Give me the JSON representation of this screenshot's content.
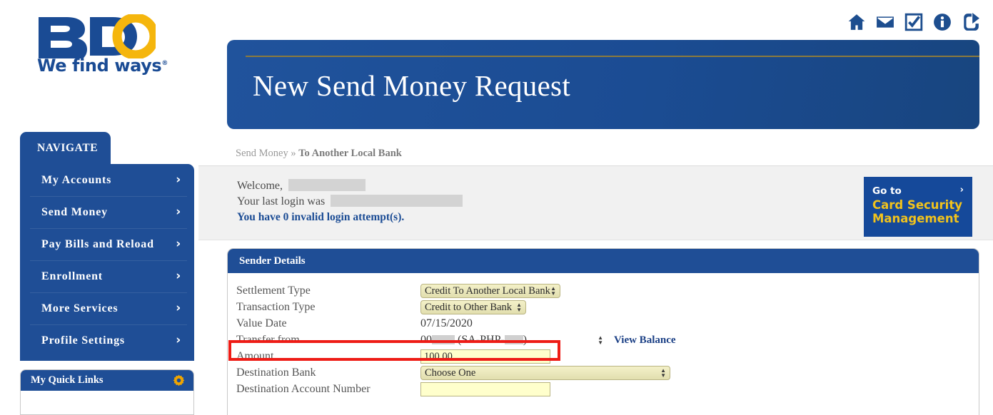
{
  "brand": {
    "name": "BDO",
    "tagline": "We find ways",
    "registered_mark": "®",
    "blue": "#1a4b94",
    "gold": "#f5b60d"
  },
  "topbar": {
    "icons": [
      {
        "name": "home-icon",
        "title": "Home"
      },
      {
        "name": "envelope-icon",
        "title": "Messages"
      },
      {
        "name": "checkbox-checked-icon",
        "title": "Tasks"
      },
      {
        "name": "info-icon",
        "title": "Information"
      },
      {
        "name": "share-icon",
        "title": "Share"
      }
    ]
  },
  "sidebar": {
    "tab_label": "NAVIGATE",
    "chevron": "›",
    "items": [
      {
        "label": "My Accounts"
      },
      {
        "label": "Send Money"
      },
      {
        "label": "Pay Bills and Reload"
      },
      {
        "label": "Enrollment"
      },
      {
        "label": "More Services"
      },
      {
        "label": "Profile Settings"
      }
    ],
    "quick_links": {
      "title": "My Quick Links",
      "gear_icon": "gear-icon"
    }
  },
  "banner": {
    "title": "New Send Money Request"
  },
  "breadcrumb": {
    "root": "Send Money",
    "separator": "»",
    "current": "To Another Local Bank"
  },
  "welcome": {
    "greeting": "Welcome,",
    "name_redacted": true,
    "last_login_label": "Your last login was",
    "last_login_redacted": true,
    "invalid_attempts": "You have 0 invalid login attempt(s)."
  },
  "card_security": {
    "goto": "Go to",
    "title_line1": "Card Security",
    "title_line2": "Management",
    "chevron": "›",
    "bg": "#15499a",
    "accent": "#f2c31c"
  },
  "form": {
    "panel_title": "Sender Details",
    "rows": [
      {
        "label": "Settlement Type",
        "type": "select",
        "value": "Credit To Another Local Bank",
        "name": "settlement-type-select"
      },
      {
        "label": "Transaction Type",
        "type": "select",
        "value": "Credit to Other Bank",
        "name": "transaction-type-select"
      },
      {
        "label": "Value Date",
        "type": "text-static",
        "value": "07/15/2020",
        "name": "value-date-value"
      },
      {
        "label": "Transfer from",
        "type": "select-masked",
        "value_prefix": "00",
        "value_middle": "(SA-PHP-",
        "value_suffix": ")",
        "link": "View Balance",
        "name": "transfer-from-select"
      },
      {
        "label": "Amount",
        "type": "input",
        "value": "100.00",
        "highlighted": true,
        "name": "amount-input"
      },
      {
        "label": "Destination Bank",
        "type": "select",
        "value": "Choose One",
        "name": "destination-bank-select"
      },
      {
        "label": "Destination Account Number",
        "type": "input",
        "value": "",
        "name": "destination-account-number-input"
      }
    ]
  },
  "annotation": {
    "highlight_color": "#ee1c16",
    "target": "Amount"
  }
}
